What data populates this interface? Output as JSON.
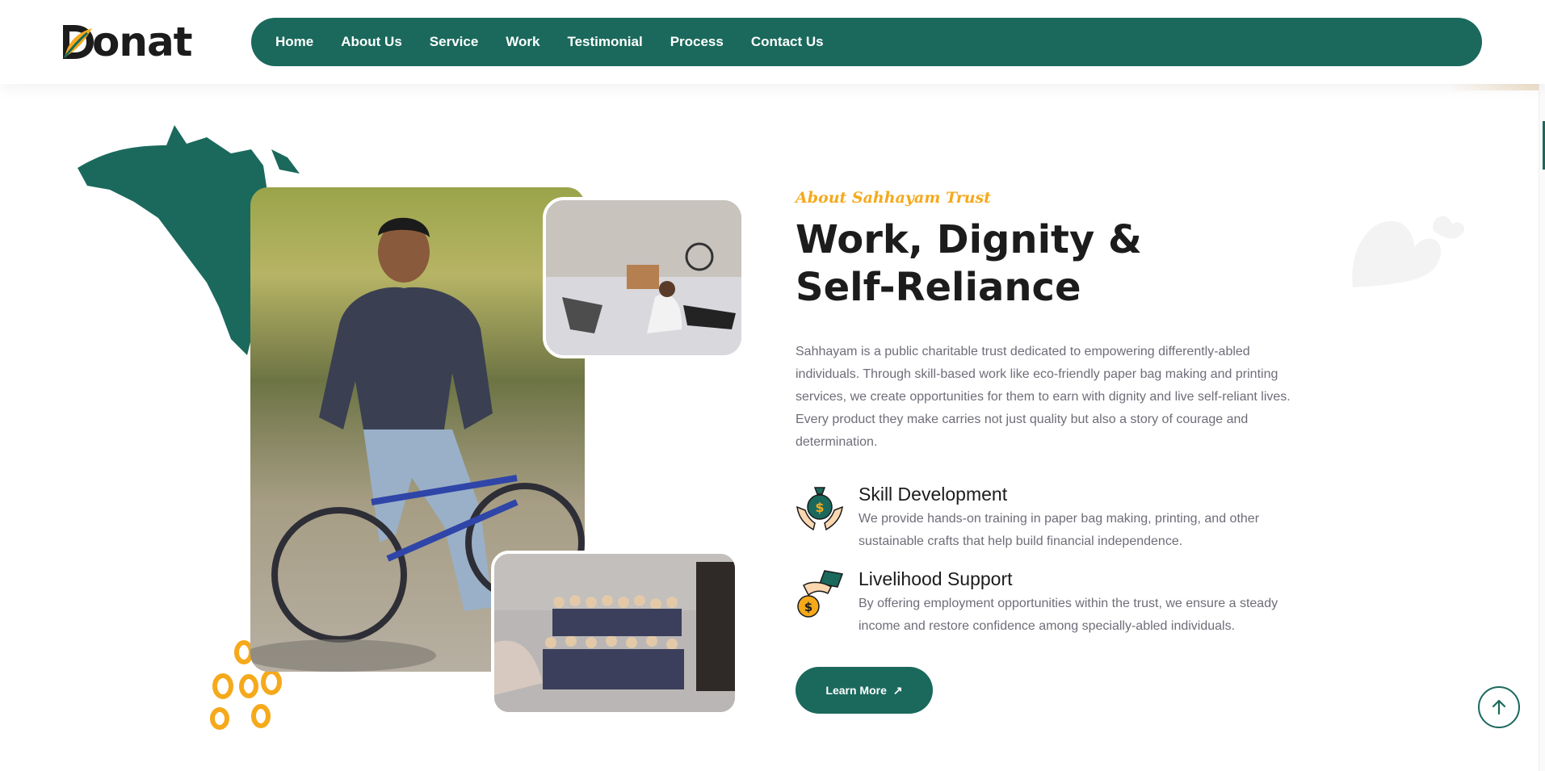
{
  "header": {
    "logo_text": "onat",
    "nav": [
      "Home",
      "About Us",
      "Service",
      "Work",
      "Testimonial",
      "Process",
      "Contact Us"
    ]
  },
  "about": {
    "eyebrow": "About Sahhayam Trust",
    "title": "Work, Dignity & Self-Reliance",
    "paragraph": "Sahhayam is a public charitable trust dedicated to empowering differently-abled individuals. Through skill-based work like eco-friendly paper bag making and printing services, we create opportunities for them to earn with dignity and live self-reliant lives. Every product they make carries not just quality but also a story of courage and determination.",
    "features": [
      {
        "icon": "money-bag-hands-icon",
        "title": "Skill Development",
        "desc": "We provide hands-on training in paper bag making, printing, and other sustainable crafts that help build financial independence."
      },
      {
        "icon": "hand-coin-icon",
        "title": "Livelihood Support",
        "desc": "By offering employment opportunities within the trust, we ensure a steady income and restore confidence among specially-abled individuals."
      }
    ],
    "cta_label": "Learn More",
    "cta_icon": "arrow-up-right-icon"
  },
  "images": {
    "main": "man-in-wheelchair-photo",
    "top": "workshop-photo",
    "bottom": "group-photo"
  },
  "colors": {
    "primary": "#1a695c",
    "accent": "#f5a91b",
    "text": "#1c1c1c",
    "muted": "#6f6d78"
  }
}
